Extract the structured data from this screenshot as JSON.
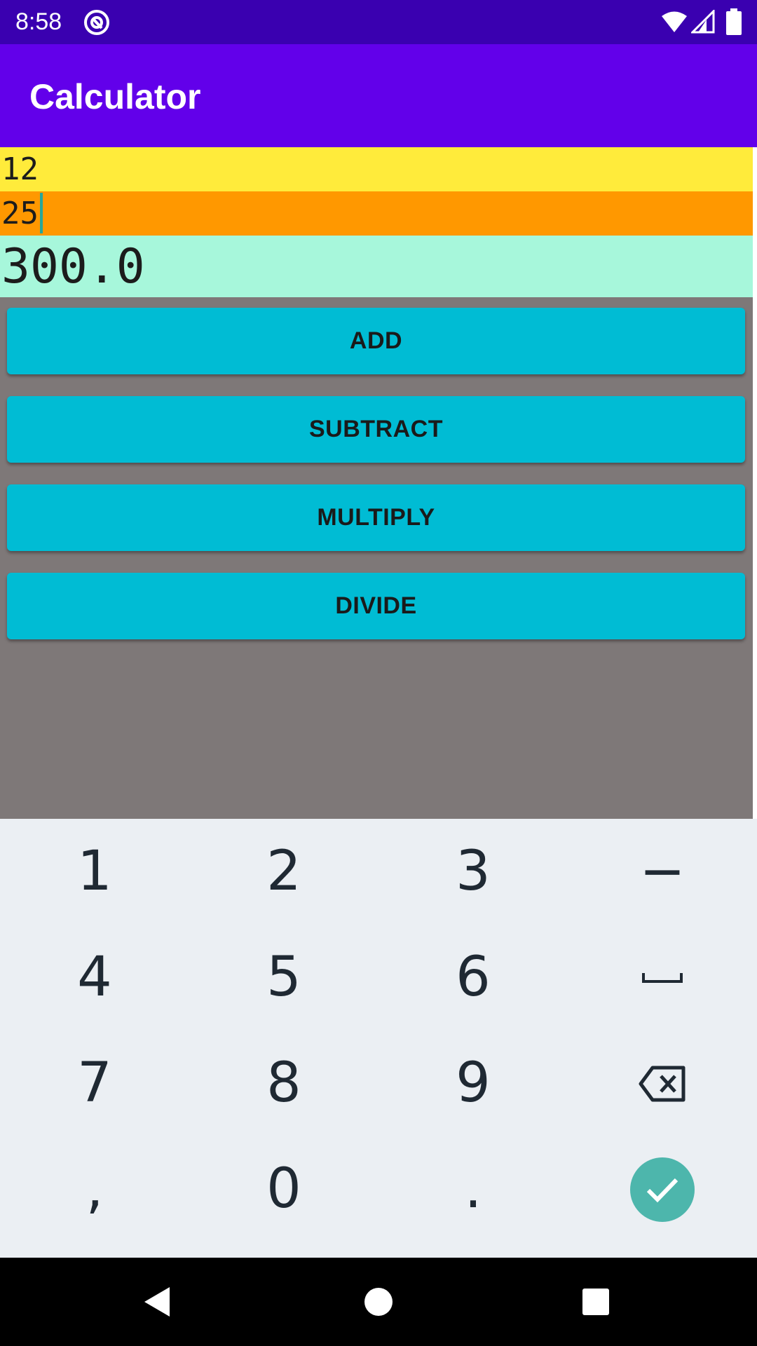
{
  "status_bar": {
    "time": "8:58",
    "icons": [
      "app-notification-icon",
      "wifi-icon",
      "signal-icon",
      "battery-icon"
    ]
  },
  "app_bar": {
    "title": "Calculator",
    "color": "#6200ea"
  },
  "inputs": {
    "first_number": "12",
    "second_number": "25",
    "result": "300.0"
  },
  "operations": {
    "add": "ADD",
    "subtract": "SUBTRACT",
    "multiply": "MULTIPLY",
    "divide": "DIVIDE"
  },
  "keyboard": {
    "row1": [
      "1",
      "2",
      "3",
      "−"
    ],
    "row2": [
      "4",
      "5",
      "6",
      "space-icon"
    ],
    "row3": [
      "7",
      "8",
      "9",
      "backspace-icon"
    ],
    "row4": [
      ",",
      "0",
      ".",
      "done-check-icon"
    ]
  },
  "colors": {
    "status_bar": "#3a00b0",
    "app_bar": "#6200ea",
    "first_field": "#ffeb3b",
    "second_field": "#ff9800",
    "result_field": "#a7f7db",
    "buttons": "#00bcd4",
    "background": "#7e7878",
    "keyboard": "#ebeff3",
    "done_key": "#4db6ac"
  },
  "nav_bar": {
    "icons": [
      "back-icon",
      "home-icon",
      "recents-icon"
    ]
  }
}
